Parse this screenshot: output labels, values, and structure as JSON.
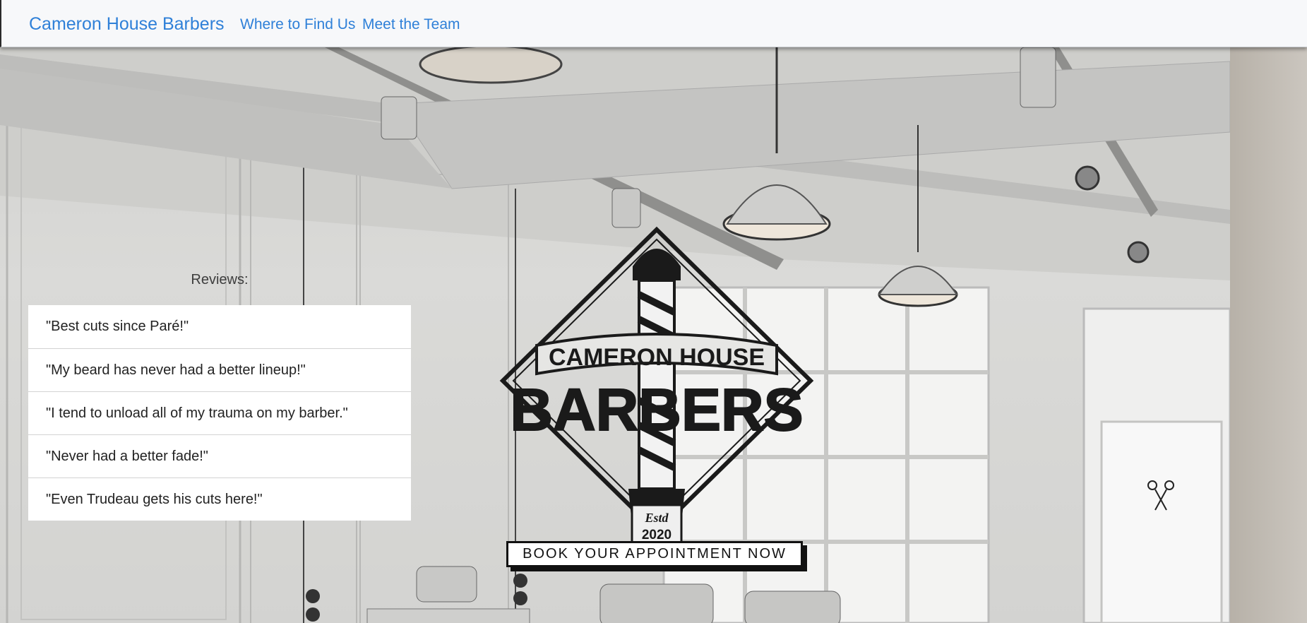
{
  "navbar": {
    "brand": "Cameron House Barbers",
    "links": [
      "Where to Find Us",
      "Meet the Team"
    ]
  },
  "reviews": {
    "heading": "Reviews:",
    "items": [
      "\"Best cuts since Paré!\"",
      "\"My beard has never had a better lineup!\"",
      "\"I tend to unload all of my trauma on my barber.\"",
      "\"Never had a better fade!\"",
      "\"Even Trudeau gets his cuts here!\""
    ]
  },
  "logo": {
    "line1": "CAMERON HOUSE",
    "line2": "BARBERS",
    "estd": "Estd",
    "year": "2020"
  },
  "cta": {
    "label": "BOOK YOUR APPOINTMENT NOW"
  },
  "colors": {
    "link": "#2f80d8",
    "navbar_bg": "#f7f8fa"
  }
}
